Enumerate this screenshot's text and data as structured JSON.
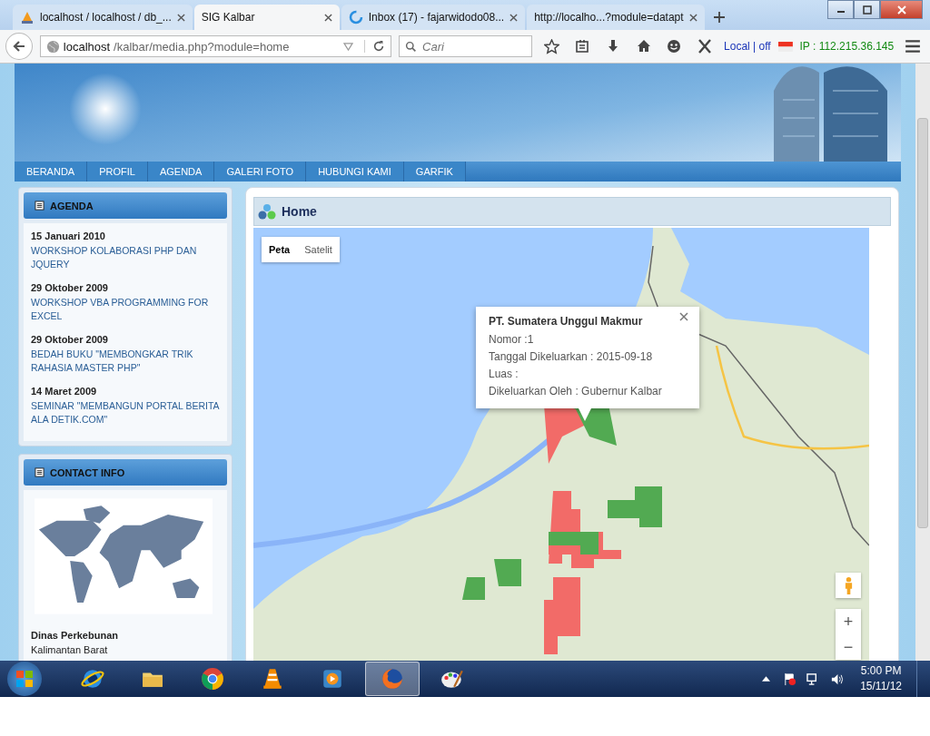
{
  "browser": {
    "tabs": [
      {
        "title": "localhost / localhost / db_...",
        "selected": false,
        "kind": "pma"
      },
      {
        "title": "SIG Kalbar",
        "selected": true,
        "kind": "none"
      },
      {
        "title": "Inbox (17) - fajarwidodo08...",
        "selected": false,
        "kind": "loading"
      },
      {
        "title": "http://localho...?module=datapt",
        "selected": false,
        "kind": "none"
      }
    ],
    "address_host": "localhost",
    "address_path": "/kalbar/media.php?module=home",
    "search_placeholder": "Cari",
    "status_local": "Local | off",
    "status_ip": "IP : 112.215.36.145"
  },
  "menu": [
    "BERANDA",
    "PROFIL",
    "AGENDA",
    "GALERI FOTO",
    "HUBUNGI KAMI",
    "GARFIK"
  ],
  "agenda": {
    "title": "AGENDA",
    "items": [
      {
        "date": "15 Januari 2010",
        "title": "WORKSHOP KOLABORASI PHP DAN JQUERY"
      },
      {
        "date": "29 Oktober 2009",
        "title": "WORKSHOP VBA PROGRAMMING FOR EXCEL"
      },
      {
        "date": "29 Oktober 2009",
        "title": "BEDAH BUKU \"MEMBONGKAR TRIK RAHASIA MASTER PHP\""
      },
      {
        "date": "14 Maret 2009",
        "title": "SEMINAR \"MEMBANGUN PORTAL BERITA ALA DETIK.COM\""
      }
    ]
  },
  "contact": {
    "title": "CONTACT INFO",
    "name": "Dinas Perkebunan",
    "address": "Kalimantan Barat"
  },
  "main": {
    "title": "Home",
    "map_types": [
      {
        "label": "Peta",
        "selected": true
      },
      {
        "label": "Satelit",
        "selected": false
      }
    ],
    "info_window": {
      "title": "PT. Sumatera Unggul Makmur",
      "lines": [
        "Nomor :1",
        "Tanggal Dikeluarkan : 2015-09-18",
        "Luas :",
        "Dikeluarkan Oleh : Gubernur Kalbar"
      ]
    },
    "zoom_in": "+",
    "zoom_out": "−"
  },
  "taskbar": {
    "apps": [
      {
        "kind": "ie",
        "selected": false
      },
      {
        "kind": "folder",
        "selected": false
      },
      {
        "kind": "chrome",
        "selected": false
      },
      {
        "kind": "vlc",
        "selected": false
      },
      {
        "kind": "media",
        "selected": false
      },
      {
        "kind": "firefox",
        "selected": true
      },
      {
        "kind": "paint",
        "selected": false
      }
    ],
    "time": "5:00 PM",
    "date": "15/11/12"
  }
}
